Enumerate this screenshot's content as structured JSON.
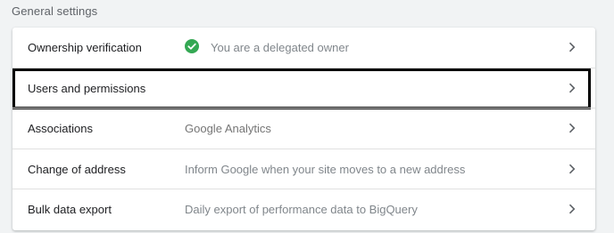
{
  "section": {
    "title": "General settings"
  },
  "rows": [
    {
      "label": "Ownership verification",
      "value": "You are a delegated owner",
      "icon": "check-circle-icon",
      "status_color": "#34a853"
    },
    {
      "label": "Users and permissions",
      "value": ""
    },
    {
      "label": "Associations",
      "value": "Google Analytics"
    },
    {
      "label": "Change of address",
      "value": "Inform Google when your site moves to a new address"
    },
    {
      "label": "Bulk data export",
      "value": "Daily export of performance data to BigQuery"
    }
  ],
  "chevron_icon": "chevron-right-icon"
}
